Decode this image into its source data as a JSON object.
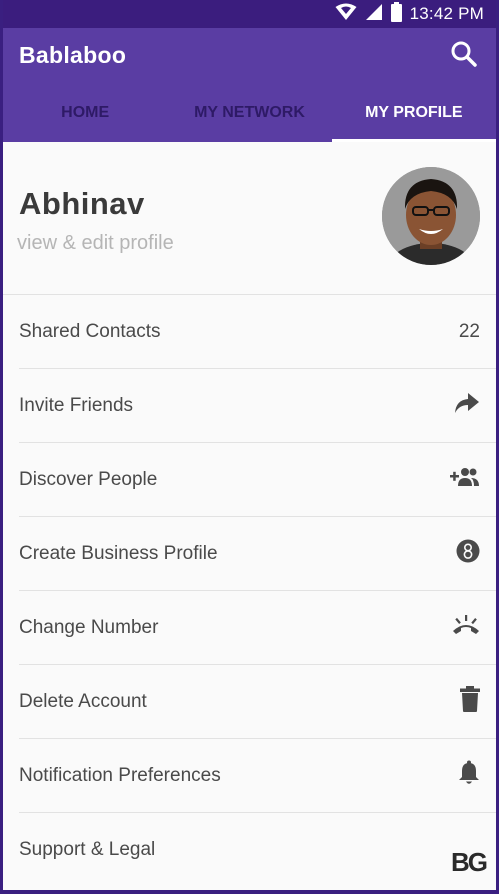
{
  "status_bar": {
    "time": "13:42 PM",
    "icons": [
      "wifi-icon",
      "signal-icon",
      "battery-icon"
    ]
  },
  "app": {
    "title": "Bablaboo",
    "search_icon": "search-icon",
    "brand_color": "#5a3da3",
    "status_color": "#3b1d7e"
  },
  "tabs": [
    {
      "label": "HOME",
      "active": false
    },
    {
      "label": "MY NETWORK",
      "active": false
    },
    {
      "label": "MY PROFILE",
      "active": true
    }
  ],
  "profile": {
    "name": "Abhinav",
    "subtitle": "view & edit profile"
  },
  "menu": [
    {
      "label": "Shared Contacts",
      "value": "22"
    },
    {
      "label": "Invite Friends",
      "icon": "share-arrow-icon"
    },
    {
      "label": "Discover People",
      "icon": "add-people-icon"
    },
    {
      "label": "Create Business Profile",
      "icon": "business-badge-icon"
    },
    {
      "label": "Change Number",
      "icon": "phone-hangup-icon"
    },
    {
      "label": "Delete Account",
      "icon": "trash-icon"
    },
    {
      "label": "Notification Preferences",
      "icon": "bell-icon"
    },
    {
      "label": "Support & Legal",
      "icon": ""
    }
  ],
  "watermark": {
    "text": "BG"
  }
}
